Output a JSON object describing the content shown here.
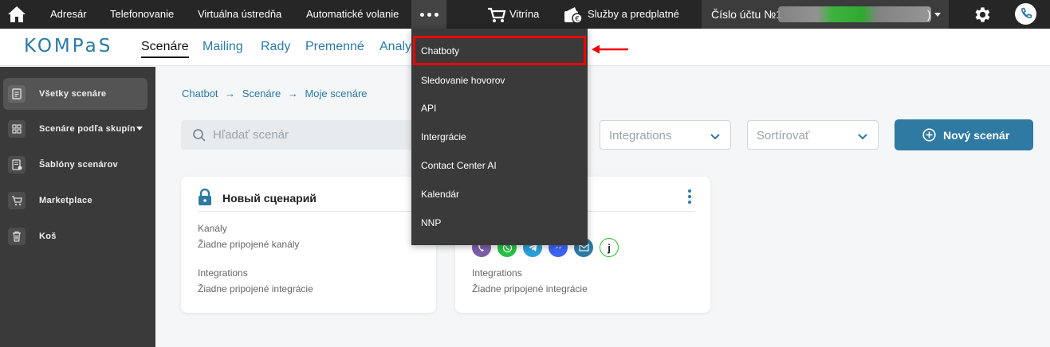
{
  "topbar": {
    "home_icon": "home-icon",
    "nav": [
      "Adresár",
      "Telefonovanie",
      "Virtuálna ústredňa",
      "Automatické volanie"
    ],
    "more_icon": "more-dots-icon",
    "vitrina": "Vitrína",
    "sluzby": "Služby a predplatné",
    "account_label": "Číslo účtu №1",
    "account_suffix": ")",
    "settings_icon": "gear-icon",
    "phone_icon": "phone-icon"
  },
  "header": {
    "logo": "KOMPaS",
    "tabs": [
      "Scenáre",
      "Mailing",
      "Rady",
      "Premenné",
      "Analy"
    ]
  },
  "sidebar": {
    "items": [
      {
        "label": "Všetky scenáre",
        "icon": "document-icon"
      },
      {
        "label": "Scenáre podľa skupín",
        "icon": "grid-icon"
      },
      {
        "label": "Šablóny scenárov",
        "icon": "template-icon"
      },
      {
        "label": "Marketplace",
        "icon": "cart-icon"
      },
      {
        "label": "Koš",
        "icon": "trash-icon"
      }
    ]
  },
  "breadcrumb": [
    "Chatbot",
    "Scenáre",
    "Moje scenáre"
  ],
  "search": {
    "placeholder": "Hľadať scenár"
  },
  "filters": {
    "integrations": "Integrations",
    "sort": "Sortírovať"
  },
  "new_button": "Nový scenár",
  "cards": [
    {
      "title": "Новый сценарий",
      "channels_label": "Kanály",
      "channels_value": "Žiadne pripojené kanály",
      "integrations_label": "Integrations",
      "integrations_value": "Žiadne pripojené integrácie"
    },
    {
      "integrations_label": "Integrations",
      "integrations_value": "Žiadne pripojené integrácie",
      "channel_letter": "j"
    }
  ],
  "dropdown": {
    "items": [
      "Chatboty",
      "Sledovanie hovorov",
      "API",
      "Intergrácie",
      "Contact Center AI",
      "Kalendár",
      "NNP"
    ],
    "highlight_color": "#e00000"
  },
  "colors": {
    "accent": "#2e7aa3",
    "topbar": "#262626",
    "sidebar": "#3a3a3a"
  }
}
